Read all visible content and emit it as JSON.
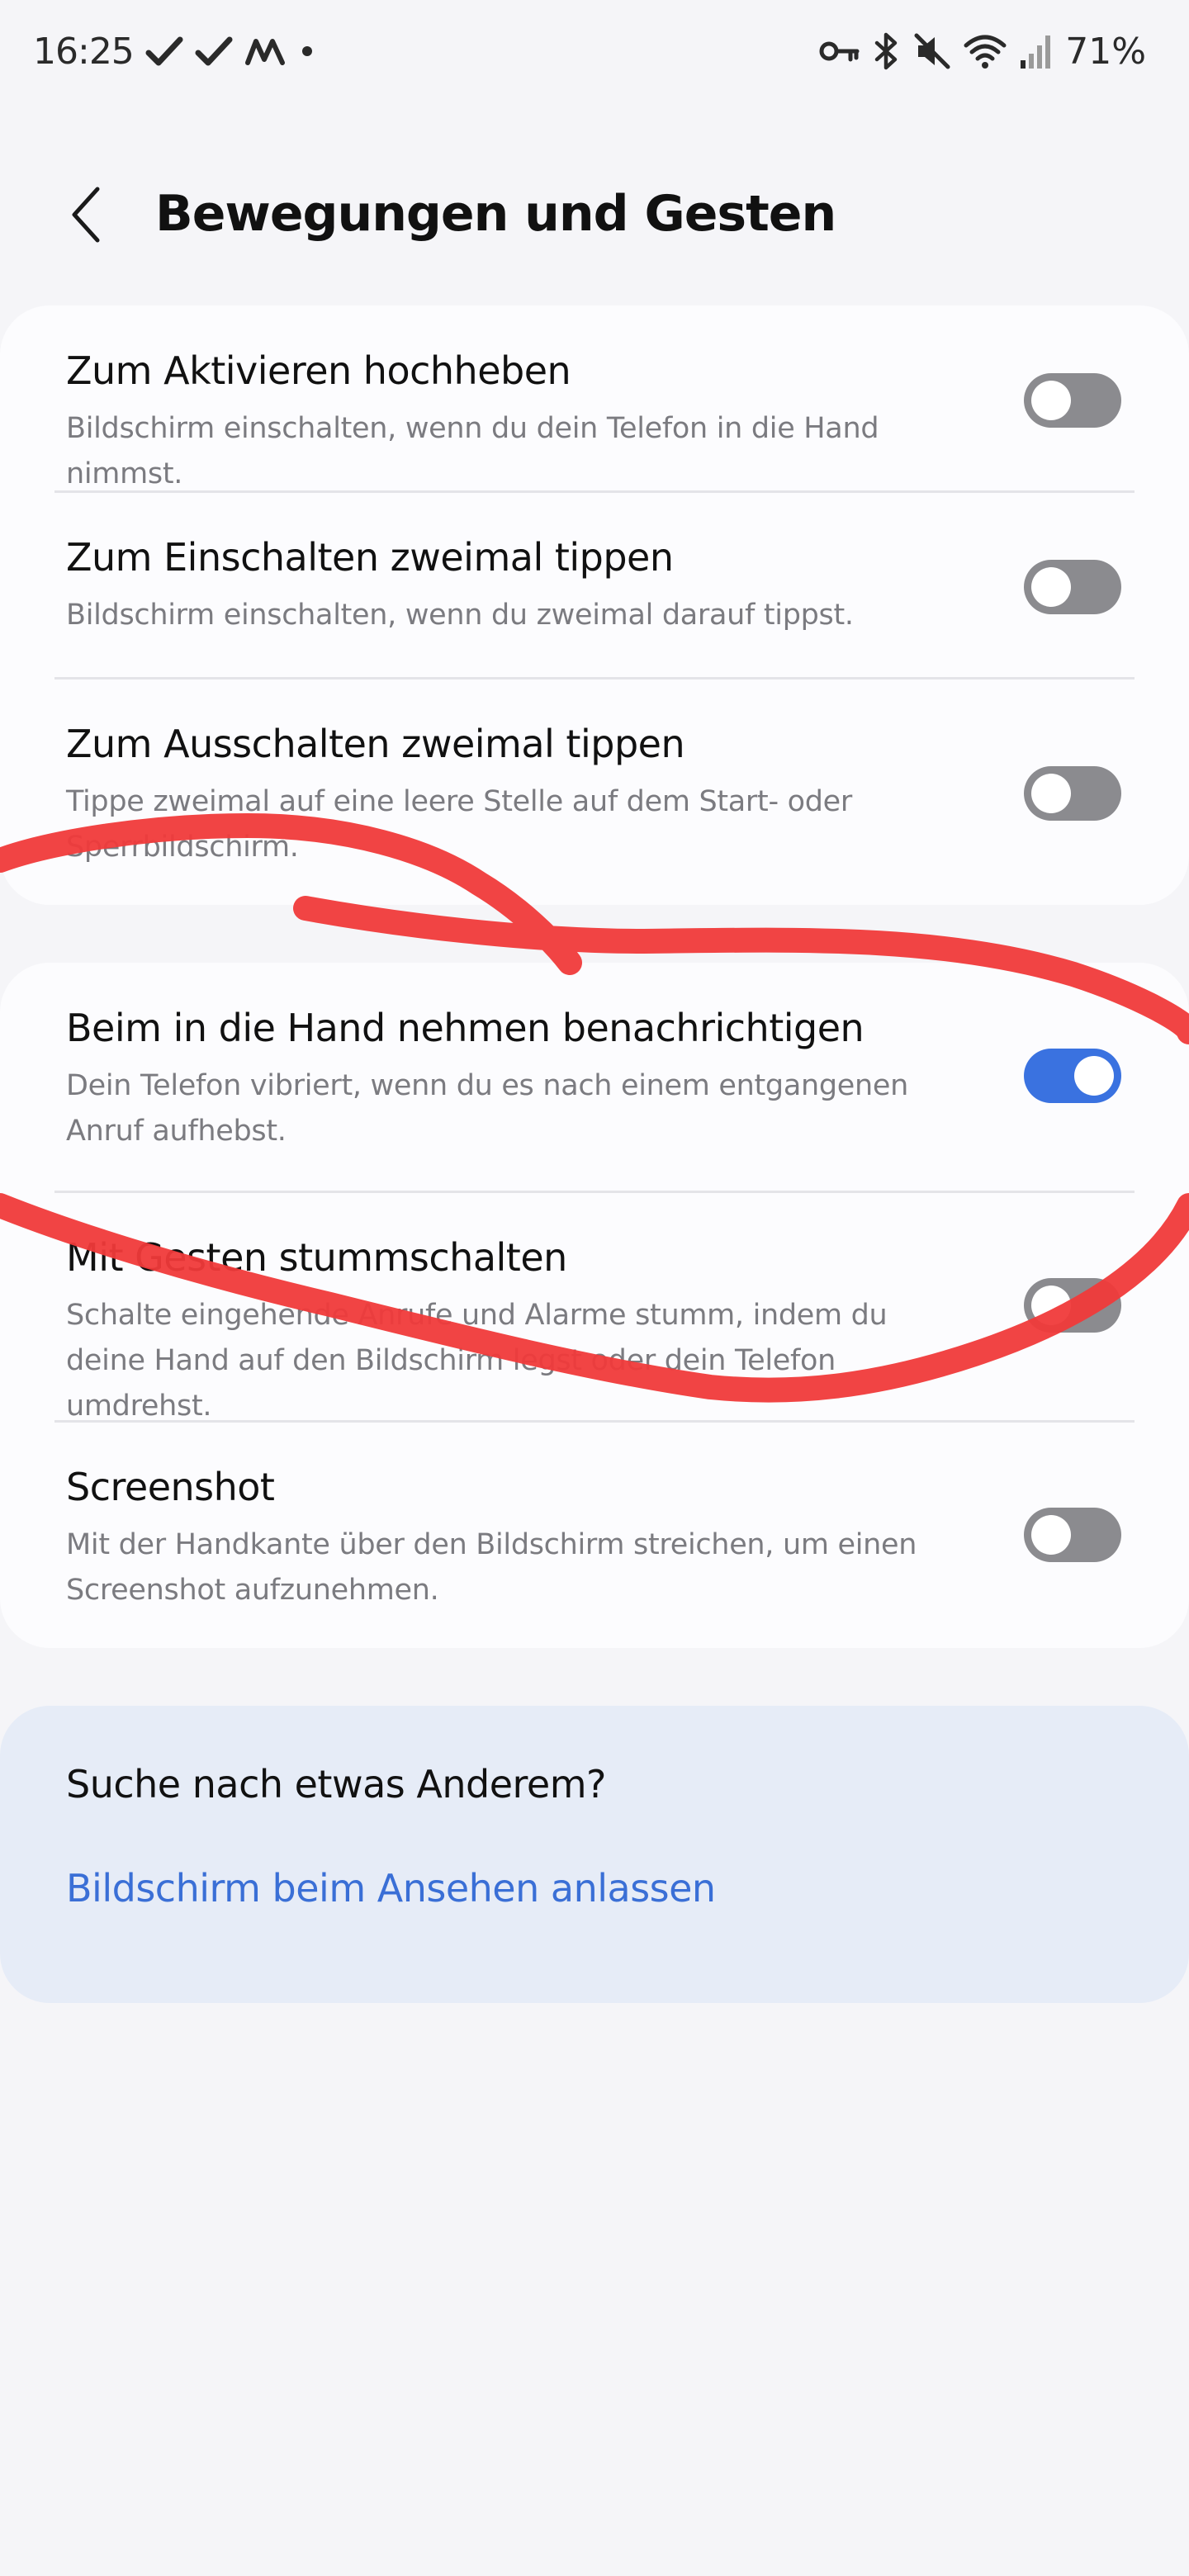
{
  "status_bar": {
    "time": "16:25",
    "battery": "71%",
    "left_icons": [
      "check-icon",
      "check-icon",
      "m-app-icon",
      "dot-icon"
    ],
    "right_icons": [
      "key-icon",
      "bluetooth-icon",
      "mute-icon",
      "wifi-icon",
      "signal-icon"
    ]
  },
  "header": {
    "title": "Bewegungen und Gesten",
    "back_icon": "chevron-left-icon"
  },
  "group1": [
    {
      "title": "Zum Aktivieren hochheben",
      "desc": "Bildschirm einschalten, wenn du dein Telefon in die Hand nimmst.",
      "enabled": false
    },
    {
      "title": "Zum Einschalten zweimal tippen",
      "desc": "Bildschirm einschalten, wenn du zweimal darauf tippst.",
      "enabled": false
    },
    {
      "title": "Zum Ausschalten zweimal tippen",
      "desc": "Tippe zweimal auf eine leere Stelle auf dem Start- oder Sperrbildschirm.",
      "enabled": false
    }
  ],
  "group2": [
    {
      "title": "Beim in die Hand nehmen benachrichtigen",
      "desc": "Dein Telefon vibriert, wenn du es nach einem entgangenen Anruf aufhebst.",
      "enabled": true
    },
    {
      "title": "Mit Gesten stummschalten",
      "desc": "Schalte eingehende Anrufe und Alarme stumm, indem du deine Hand auf den Bildschirm legst oder dein Telefon umdrehst.",
      "enabled": false
    },
    {
      "title": "Screenshot",
      "desc": "Mit der Handkante über den Bildschirm streichen, um einen Screenshot aufzunehmen.",
      "enabled": false
    }
  ],
  "suggestion": {
    "title": "Suche nach etwas Anderem?",
    "link": "Bildschirm beim Ansehen anlassen"
  },
  "colors": {
    "background": "#f5f5f8",
    "card": "#fcfcfe",
    "toggle_on": "#3a72e0",
    "toggle_off": "#8b8b8f",
    "link": "#3a6fd6",
    "annotation": "#f03a3a"
  }
}
